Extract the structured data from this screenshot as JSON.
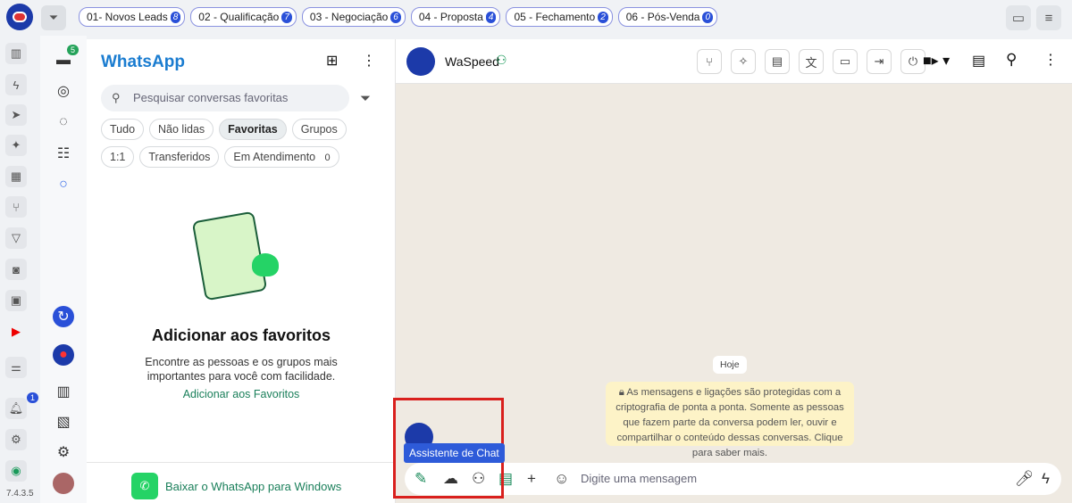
{
  "topbar": {
    "tags": [
      {
        "label": "01- Novos Leads",
        "count": "8"
      },
      {
        "label": "02 - Qualificação",
        "count": "7"
      },
      {
        "label": "03 - Negociação",
        "count": "6"
      },
      {
        "label": "04 - Proposta",
        "count": "4"
      },
      {
        "label": "05 - Fechamento",
        "count": "2"
      },
      {
        "label": "06 - Pós-Venda",
        "count": "0"
      }
    ]
  },
  "rail": {
    "version": "7.4.3.5",
    "notif_badge": "1",
    "chats_badge": "5"
  },
  "panel": {
    "title": "WhatsApp",
    "search_placeholder": "Pesquisar conversas favoritas",
    "chips": [
      "Tudo",
      "Não lidas",
      "Favoritas",
      "Grupos",
      "1:1",
      "Transferidos",
      "Em Atendimento"
    ],
    "atendimento_count": "0",
    "empty_title": "Adicionar aos favoritos",
    "empty_text": "Encontre as pessoas e os grupos mais importantes para você com facilidade.",
    "empty_link": "Adicionar aos Favoritos",
    "download": "Baixar o WhatsApp para Windows"
  },
  "chat": {
    "name": "WaSpeed",
    "today": "Hoje",
    "notice": "As mensagens e ligações são protegidas com a criptografia de ponta a ponta. Somente as pessoas que fazem parte da conversa podem ler, ouvir e compartilhar o conteúdo dessas conversas. Clique para saber mais.",
    "input_placeholder": "Digite uma mensagem",
    "tooltip": "Assistente de Chat"
  },
  "colors": {
    "accent": "#2a50d8",
    "whatsapp_green": "#25d366",
    "highlight": "#d9201d",
    "link": "#1a7f5a"
  }
}
